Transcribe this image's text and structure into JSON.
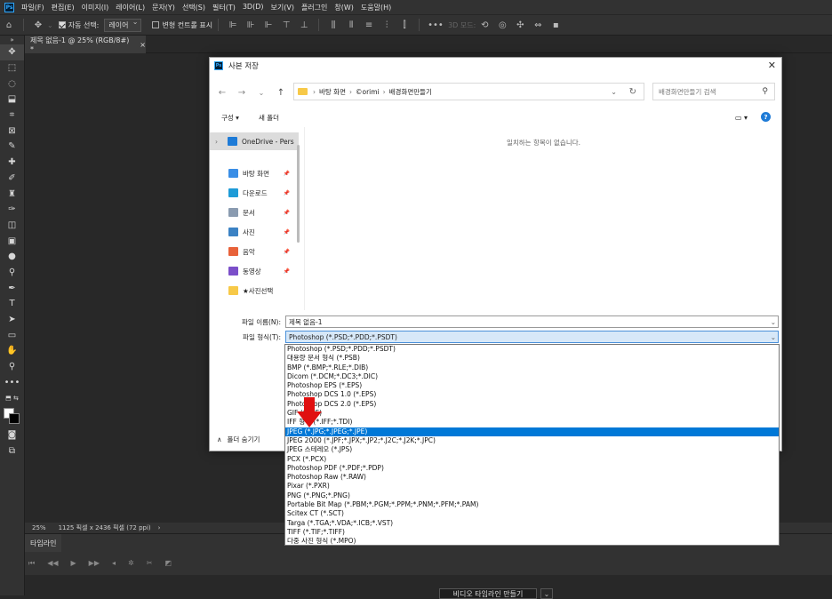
{
  "menubar": {
    "items": [
      "파일(F)",
      "편집(E)",
      "이미지(I)",
      "레이어(L)",
      "문자(Y)",
      "선택(S)",
      "필터(T)",
      "3D(D)",
      "보기(V)",
      "플러그인",
      "창(W)",
      "도움말(H)"
    ]
  },
  "options": {
    "auto_select_label": "자동 선택:",
    "auto_select_value": "레이어",
    "transform_controls_label": "변형 컨트롤 표시",
    "mode_3d_label": "3D 모드:"
  },
  "document": {
    "tab_title": "제목 없음-1 @ 25% (RGB/8#) *",
    "zoom": "25%",
    "dimensions": "1125 픽셀 x 2436 픽셀 (72 ppi)"
  },
  "timeline": {
    "tab_label": "타임라인",
    "create_button": "비디오 타임라인 만들기"
  },
  "dialog": {
    "title": "사본 저장",
    "breadcrumb": [
      "바탕 화면",
      "©orimi",
      "배경화면만들기"
    ],
    "search_placeholder": "배경화면만들기 검색",
    "organize_label": "구성 ▾",
    "new_folder_label": "새 폴더",
    "empty_message": "일치하는 항목이 없습니다.",
    "nav_items": [
      {
        "label": "OneDrive - Pers",
        "icon": "cloud-icon",
        "color": "#1e7bd7"
      },
      {
        "label": "바탕 화면",
        "icon": "desktop-icon",
        "color": "#3a8ee6"
      },
      {
        "label": "다운로드",
        "icon": "download-icon",
        "color": "#1e9bd7"
      },
      {
        "label": "문서",
        "icon": "document-icon",
        "color": "#8a9bb0"
      },
      {
        "label": "사진",
        "icon": "pictures-icon",
        "color": "#3b82c4"
      },
      {
        "label": "음악",
        "icon": "music-icon",
        "color": "#e8623a"
      },
      {
        "label": "동영상",
        "icon": "video-icon",
        "color": "#7b4fc9"
      },
      {
        "label": "★사진선택",
        "icon": "folder-icon",
        "color": "#f7c948"
      }
    ],
    "filename_label": "파일 이름(N):",
    "filename_value": "제목 없음-1",
    "filetype_label": "파일 형식(T):",
    "filetype_value": "Photoshop (*.PSD;*.PDD;*.PSDT)",
    "hide_folders_label": "폴더 숨기기",
    "filetype_options": [
      "Photoshop (*.PSD;*.PDD;*.PSDT)",
      "대용량 문서 형식 (*.PSB)",
      "BMP (*.BMP;*.RLE;*.DIB)",
      "Dicom (*.DCM;*.DC3;*.DIC)",
      "Photoshop EPS (*.EPS)",
      "Photoshop DCS 1.0 (*.EPS)",
      "Photoshop DCS 2.0 (*.EPS)",
      "GIF (*.GIF)",
      "IFF 형식 (*.IFF;*.TDI)",
      "JPEG (*.JPG;*.JPEG;*.JPE)",
      "JPEG 2000 (*.JPF;*.JPX;*.JP2;*.J2C;*.J2K;*.JPC)",
      "JPEG 스테레오 (*.JPS)",
      "PCX (*.PCX)",
      "Photoshop PDF (*.PDF;*.PDP)",
      "Photoshop Raw (*.RAW)",
      "Pixar (*.PXR)",
      "PNG (*.PNG;*.PNG)",
      "Portable Bit Map (*.PBM;*.PGM;*.PPM;*.PNM;*.PFM;*.PAM)",
      "Scitex CT (*.SCT)",
      "Targa (*.TGA;*.VDA;*.ICB;*.VST)",
      "TIFF (*.TIF;*.TIFF)",
      "다중 사진 형식 (*.MPO)"
    ],
    "highlighted_index": 9
  },
  "colors": {
    "highlight": "#0078d7",
    "arrow": "#e01010"
  }
}
